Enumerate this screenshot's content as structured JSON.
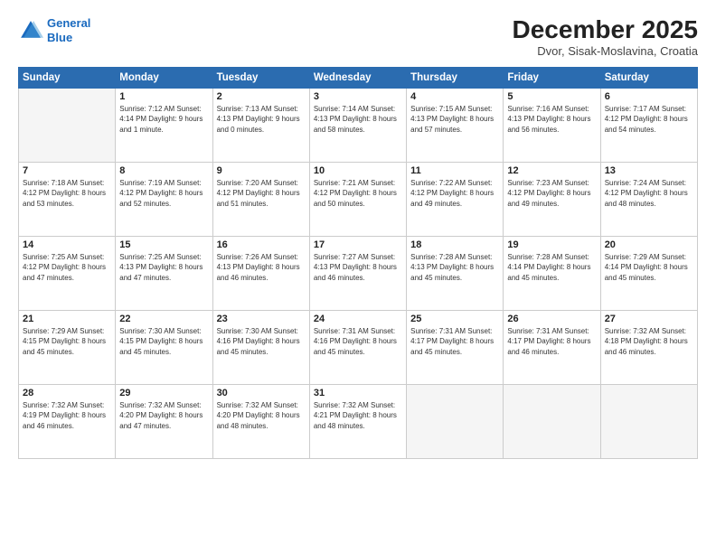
{
  "header": {
    "logo_line1": "General",
    "logo_line2": "Blue",
    "month_title": "December 2025",
    "subtitle": "Dvor, Sisak-Moslavina, Croatia"
  },
  "weekdays": [
    "Sunday",
    "Monday",
    "Tuesday",
    "Wednesday",
    "Thursday",
    "Friday",
    "Saturday"
  ],
  "weeks": [
    [
      {
        "day": "",
        "detail": ""
      },
      {
        "day": "1",
        "detail": "Sunrise: 7:12 AM\nSunset: 4:14 PM\nDaylight: 9 hours\nand 1 minute."
      },
      {
        "day": "2",
        "detail": "Sunrise: 7:13 AM\nSunset: 4:13 PM\nDaylight: 9 hours\nand 0 minutes."
      },
      {
        "day": "3",
        "detail": "Sunrise: 7:14 AM\nSunset: 4:13 PM\nDaylight: 8 hours\nand 58 minutes."
      },
      {
        "day": "4",
        "detail": "Sunrise: 7:15 AM\nSunset: 4:13 PM\nDaylight: 8 hours\nand 57 minutes."
      },
      {
        "day": "5",
        "detail": "Sunrise: 7:16 AM\nSunset: 4:13 PM\nDaylight: 8 hours\nand 56 minutes."
      },
      {
        "day": "6",
        "detail": "Sunrise: 7:17 AM\nSunset: 4:12 PM\nDaylight: 8 hours\nand 54 minutes."
      }
    ],
    [
      {
        "day": "7",
        "detail": "Sunrise: 7:18 AM\nSunset: 4:12 PM\nDaylight: 8 hours\nand 53 minutes."
      },
      {
        "day": "8",
        "detail": "Sunrise: 7:19 AM\nSunset: 4:12 PM\nDaylight: 8 hours\nand 52 minutes."
      },
      {
        "day": "9",
        "detail": "Sunrise: 7:20 AM\nSunset: 4:12 PM\nDaylight: 8 hours\nand 51 minutes."
      },
      {
        "day": "10",
        "detail": "Sunrise: 7:21 AM\nSunset: 4:12 PM\nDaylight: 8 hours\nand 50 minutes."
      },
      {
        "day": "11",
        "detail": "Sunrise: 7:22 AM\nSunset: 4:12 PM\nDaylight: 8 hours\nand 49 minutes."
      },
      {
        "day": "12",
        "detail": "Sunrise: 7:23 AM\nSunset: 4:12 PM\nDaylight: 8 hours\nand 49 minutes."
      },
      {
        "day": "13",
        "detail": "Sunrise: 7:24 AM\nSunset: 4:12 PM\nDaylight: 8 hours\nand 48 minutes."
      }
    ],
    [
      {
        "day": "14",
        "detail": "Sunrise: 7:25 AM\nSunset: 4:12 PM\nDaylight: 8 hours\nand 47 minutes."
      },
      {
        "day": "15",
        "detail": "Sunrise: 7:25 AM\nSunset: 4:13 PM\nDaylight: 8 hours\nand 47 minutes."
      },
      {
        "day": "16",
        "detail": "Sunrise: 7:26 AM\nSunset: 4:13 PM\nDaylight: 8 hours\nand 46 minutes."
      },
      {
        "day": "17",
        "detail": "Sunrise: 7:27 AM\nSunset: 4:13 PM\nDaylight: 8 hours\nand 46 minutes."
      },
      {
        "day": "18",
        "detail": "Sunrise: 7:28 AM\nSunset: 4:13 PM\nDaylight: 8 hours\nand 45 minutes."
      },
      {
        "day": "19",
        "detail": "Sunrise: 7:28 AM\nSunset: 4:14 PM\nDaylight: 8 hours\nand 45 minutes."
      },
      {
        "day": "20",
        "detail": "Sunrise: 7:29 AM\nSunset: 4:14 PM\nDaylight: 8 hours\nand 45 minutes."
      }
    ],
    [
      {
        "day": "21",
        "detail": "Sunrise: 7:29 AM\nSunset: 4:15 PM\nDaylight: 8 hours\nand 45 minutes."
      },
      {
        "day": "22",
        "detail": "Sunrise: 7:30 AM\nSunset: 4:15 PM\nDaylight: 8 hours\nand 45 minutes."
      },
      {
        "day": "23",
        "detail": "Sunrise: 7:30 AM\nSunset: 4:16 PM\nDaylight: 8 hours\nand 45 minutes."
      },
      {
        "day": "24",
        "detail": "Sunrise: 7:31 AM\nSunset: 4:16 PM\nDaylight: 8 hours\nand 45 minutes."
      },
      {
        "day": "25",
        "detail": "Sunrise: 7:31 AM\nSunset: 4:17 PM\nDaylight: 8 hours\nand 45 minutes."
      },
      {
        "day": "26",
        "detail": "Sunrise: 7:31 AM\nSunset: 4:17 PM\nDaylight: 8 hours\nand 46 minutes."
      },
      {
        "day": "27",
        "detail": "Sunrise: 7:32 AM\nSunset: 4:18 PM\nDaylight: 8 hours\nand 46 minutes."
      }
    ],
    [
      {
        "day": "28",
        "detail": "Sunrise: 7:32 AM\nSunset: 4:19 PM\nDaylight: 8 hours\nand 46 minutes."
      },
      {
        "day": "29",
        "detail": "Sunrise: 7:32 AM\nSunset: 4:20 PM\nDaylight: 8 hours\nand 47 minutes."
      },
      {
        "day": "30",
        "detail": "Sunrise: 7:32 AM\nSunset: 4:20 PM\nDaylight: 8 hours\nand 48 minutes."
      },
      {
        "day": "31",
        "detail": "Sunrise: 7:32 AM\nSunset: 4:21 PM\nDaylight: 8 hours\nand 48 minutes."
      },
      {
        "day": "",
        "detail": ""
      },
      {
        "day": "",
        "detail": ""
      },
      {
        "day": "",
        "detail": ""
      }
    ]
  ]
}
